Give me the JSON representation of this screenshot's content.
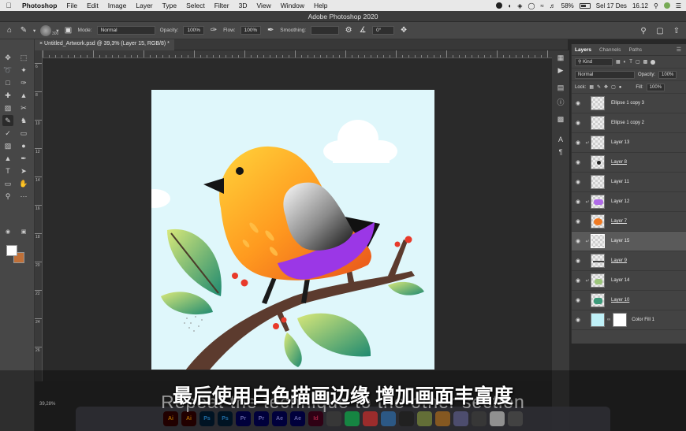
{
  "menubar": {
    "app_name": "Photoshop",
    "menus": [
      "File",
      "Edit",
      "Image",
      "Layer",
      "Type",
      "Select",
      "Filter",
      "3D",
      "View",
      "Window",
      "Help"
    ],
    "battery": "58%",
    "date": "Sel 17 Des",
    "time": "16.12"
  },
  "window": {
    "title": "Adobe Photoshop 2020"
  },
  "options": {
    "brush_size": "300",
    "mode_label": "Mode:",
    "mode_value": "Normal",
    "opacity_label": "Opacity:",
    "opacity_value": "100%",
    "flow_label": "Flow:",
    "flow_value": "100%",
    "smoothing_label": "Smoothing:",
    "angle_value": "0°"
  },
  "document": {
    "tab_title": "Untitled_Artwork.psd @ 39,3% (Layer 15, RGB/8) *",
    "zoom": "39,28%"
  },
  "ruler_numbers": [
    "6",
    "8",
    "10",
    "12",
    "14",
    "16",
    "18",
    "20",
    "22",
    "24",
    "26"
  ],
  "layers_panel": {
    "tabs": [
      "Layers",
      "Channels",
      "Paths"
    ],
    "filter_kind": "Kind",
    "blend_mode": "Normal",
    "opacity_label": "Opacity:",
    "opacity_value": "100%",
    "lock_label": "Lock:",
    "fill_label": "Fill:",
    "fill_value": "100%",
    "layers": [
      {
        "name": "Ellipse 1 copy 3",
        "clip": false,
        "underline": false,
        "selected": false
      },
      {
        "name": "Ellipse 1 copy 2",
        "clip": false,
        "underline": false,
        "selected": false
      },
      {
        "name": "Layer 13",
        "clip": true,
        "underline": false,
        "selected": false
      },
      {
        "name": "Layer 8",
        "clip": false,
        "underline": true,
        "selected": false
      },
      {
        "name": "Layer 11",
        "clip": false,
        "underline": false,
        "selected": false
      },
      {
        "name": "Layer 12",
        "clip": true,
        "underline": false,
        "selected": false
      },
      {
        "name": "Layer 7",
        "clip": false,
        "underline": true,
        "selected": false
      },
      {
        "name": "Layer 15",
        "clip": true,
        "underline": false,
        "selected": true
      },
      {
        "name": "Layer 9",
        "clip": false,
        "underline": true,
        "selected": false
      },
      {
        "name": "Layer 14",
        "clip": true,
        "underline": false,
        "selected": false
      },
      {
        "name": "Layer 10",
        "clip": false,
        "underline": true,
        "selected": false
      },
      {
        "name": "Color Fill 1",
        "clip": false,
        "underline": false,
        "selected": false
      }
    ]
  },
  "subtitles": {
    "english": "Repeat the technique to the other section",
    "chinese": "最后使用白色描画边缘 增加画面丰富度"
  },
  "dock_apps": [
    {
      "label": "Ai",
      "color": "#ff9a00",
      "bg": "#330000"
    },
    {
      "label": "Ai",
      "color": "#ff9a00",
      "bg": "#330000"
    },
    {
      "label": "Ps",
      "color": "#31a8ff",
      "bg": "#001e36"
    },
    {
      "label": "Ps",
      "color": "#31a8ff",
      "bg": "#001e36"
    },
    {
      "label": "Pr",
      "color": "#9999ff",
      "bg": "#00005b"
    },
    {
      "label": "Pr",
      "color": "#9999ff",
      "bg": "#00005b"
    },
    {
      "label": "Ae",
      "color": "#9999ff",
      "bg": "#00005b"
    },
    {
      "label": "Ae",
      "color": "#9999ff",
      "bg": "#00005b"
    },
    {
      "label": "Id",
      "color": "#ff3366",
      "bg": "#49021f"
    },
    {
      "label": "",
      "color": "#fff",
      "bg": "#555"
    },
    {
      "label": "",
      "color": "#fff",
      "bg": "#2c6"
    },
    {
      "label": "",
      "color": "#fff",
      "bg": "#e44"
    },
    {
      "label": "",
      "color": "#fff",
      "bg": "#48c"
    },
    {
      "label": "",
      "color": "#fff",
      "bg": "#333"
    },
    {
      "label": "",
      "color": "#fff",
      "bg": "#9a5"
    },
    {
      "label": "",
      "color": "#fff",
      "bg": "#c83"
    },
    {
      "label": "",
      "color": "#fff",
      "bg": "#77a"
    },
    {
      "label": "",
      "color": "#fff",
      "bg": "#555"
    },
    {
      "label": "",
      "color": "#fff",
      "bg": "#ddd"
    },
    {
      "label": "",
      "color": "#fff",
      "bg": "#666"
    }
  ],
  "colors": {
    "canvas_bg": "#dff7fb",
    "foreground_swatch": "#ffffff",
    "background_swatch": "#c07038"
  }
}
